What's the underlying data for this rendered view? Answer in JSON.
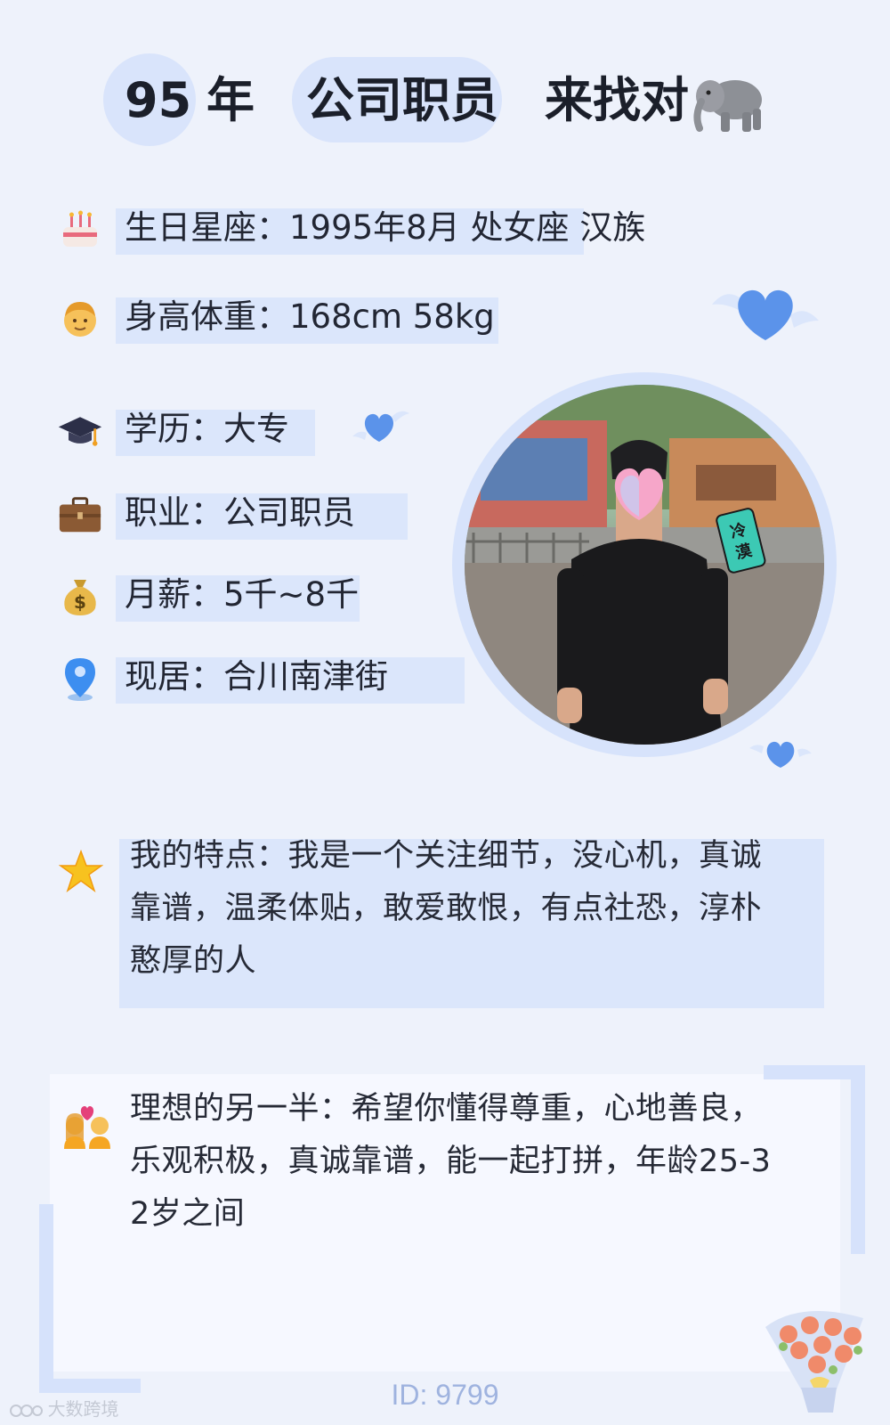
{
  "header": {
    "year": "95",
    "year_suffix": "年",
    "job_tag": "公司职员",
    "seeking": "来找对",
    "seeking_icon": "elephant-emoji"
  },
  "info": [
    {
      "icon": "birthday-cake-emoji",
      "text": "生日星座：1995年8月 处女座 汉族"
    },
    {
      "icon": "man-face-emoji",
      "text": "身高体重：168cm 58kg"
    },
    {
      "icon": "graduation-cap-emoji",
      "text": "学历：大专"
    },
    {
      "icon": "briefcase-emoji",
      "text": "职业：公司职员"
    },
    {
      "icon": "money-bag-emoji",
      "text": "月薪：5千~8千"
    },
    {
      "icon": "location-pin-emoji",
      "text": "现居：合川南津街"
    }
  ],
  "photo": {
    "sticker_text": "冷漠",
    "face_cover": "heart-sticker"
  },
  "features": {
    "icon": "sparkle-star-emoji",
    "lines": [
      "我的特点：我是一个关注细节，没心机，真诚",
      "靠谱，温柔体贴，敢爱敢恨，有点社恐，淳朴",
      "憨厚的人"
    ]
  },
  "ideal": {
    "icon": "couple-with-heart-emoji",
    "lines": [
      "理想的另一半：希望你懂得尊重，心地善良，",
      "乐观积极，真诚靠谱，能一起打拼，年龄25-3",
      "2岁之间"
    ]
  },
  "footer": {
    "id": "ID: 9799",
    "watermark": "大数跨境"
  },
  "colors": {
    "background": "#eef2fb",
    "highlight": "#dbe6fb",
    "heart": "#5b93ea",
    "id_text": "#9fb3df"
  }
}
